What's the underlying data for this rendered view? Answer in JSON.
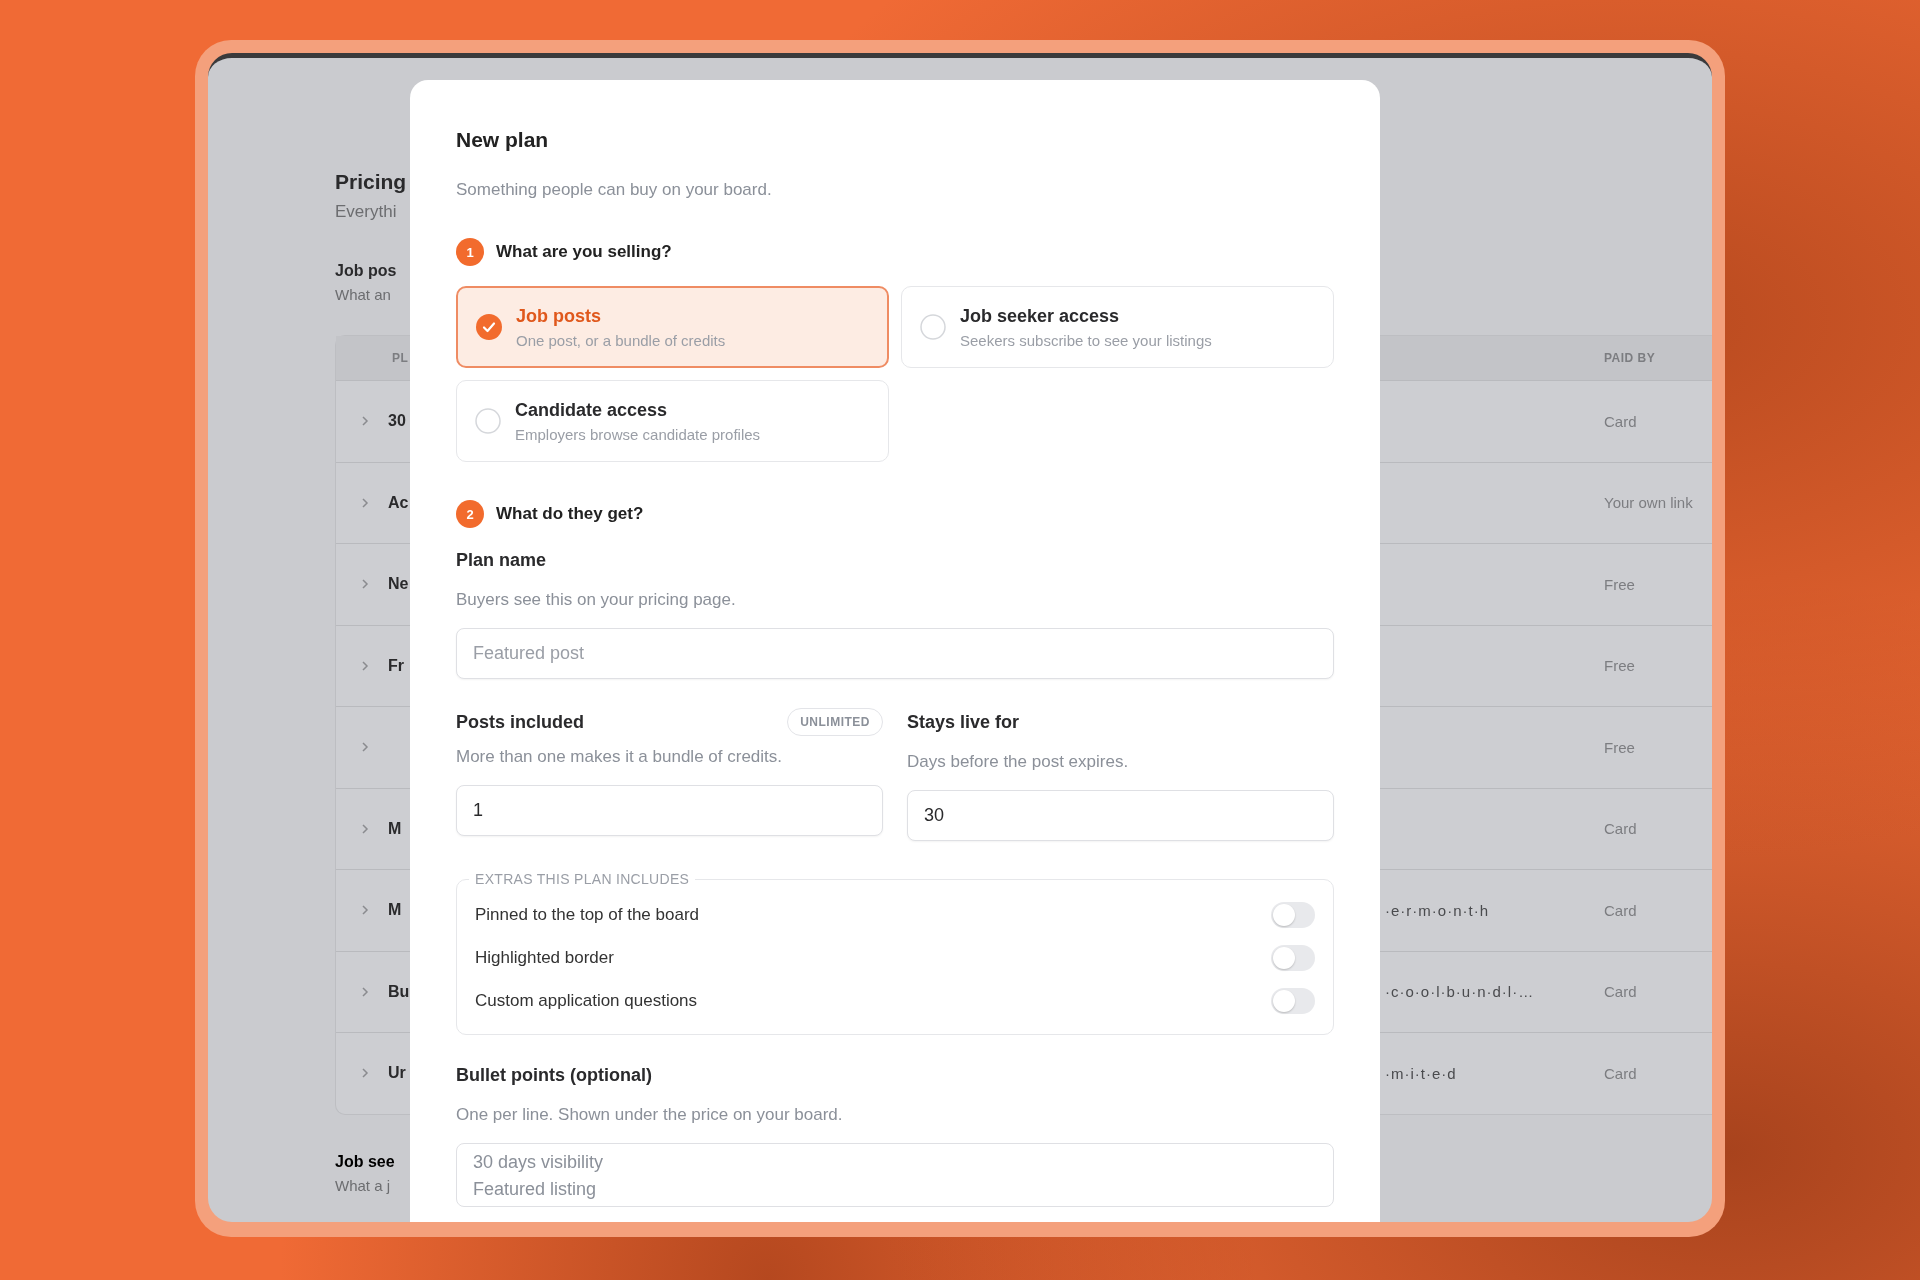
{
  "background_page": {
    "title": "Pricing",
    "subtitle": "Everythi",
    "sections": [
      {
        "title": "Job pos",
        "description": "What an"
      },
      {
        "title": "Job see",
        "description": "What a j"
      }
    ],
    "table": {
      "columns": [
        "PL",
        "PAID BY"
      ],
      "rows": [
        {
          "column_1": "30",
          "paid_by": "Card"
        },
        {
          "column_1": "Ac",
          "paid_by": "Your own link"
        },
        {
          "column_1": "Ne",
          "paid_by": "Free"
        },
        {
          "column_1": "Fr",
          "paid_by": "Free"
        },
        {
          "paid_by": "Free"
        },
        {
          "column_1": "M",
          "paid_by": "Card"
        },
        {
          "column_1": "M",
          "column_2": "·e·r·m·o·n·t·h",
          "paid_by": "Card"
        },
        {
          "column_1": "Bu",
          "column_2": "·c·o·o·l·b·u·n·d·l·…",
          "paid_by": "Card"
        },
        {
          "column_1": "Ur",
          "column_2": "·m·i·t·e·d",
          "paid_by": "Card"
        }
      ]
    }
  },
  "dialog": {
    "title": "New plan",
    "subtitle": "Something people can buy on your board.",
    "steps": [
      {
        "number": "1",
        "label": "What are you selling?"
      },
      {
        "number": "2",
        "label": "What do they get?"
      }
    ],
    "options": [
      {
        "title": "Job posts",
        "description": "One post, or a bundle of credits",
        "selected": true
      },
      {
        "title": "Job seeker access",
        "description": "Seekers subscribe to see your listings",
        "selected": false
      },
      {
        "title": "Candidate access",
        "description": "Employers browse candidate profiles",
        "selected": false
      }
    ],
    "plan_name": {
      "label": "Plan name",
      "help": "Buyers see this on your pricing page.",
      "placeholder": "Featured post"
    },
    "posts_included": {
      "label": "Posts included",
      "badge": "UNLIMITED",
      "help": "More than one makes it a bundle of credits.",
      "value": "1"
    },
    "stays_live": {
      "label": "Stays live for",
      "help": "Days before the post expires.",
      "value": "30"
    },
    "extras": {
      "legend": "EXTRAS THIS PLAN INCLUDES",
      "items": [
        {
          "label": "Pinned to the top of the board",
          "on": false
        },
        {
          "label": "Highlighted border",
          "on": false
        },
        {
          "label": "Custom application questions",
          "on": false
        }
      ]
    },
    "bullets": {
      "label": "Bullet points (optional)",
      "help": "One per line. Shown under the price on your board.",
      "lines": [
        "30 days visibility",
        "Featured listing"
      ]
    }
  }
}
